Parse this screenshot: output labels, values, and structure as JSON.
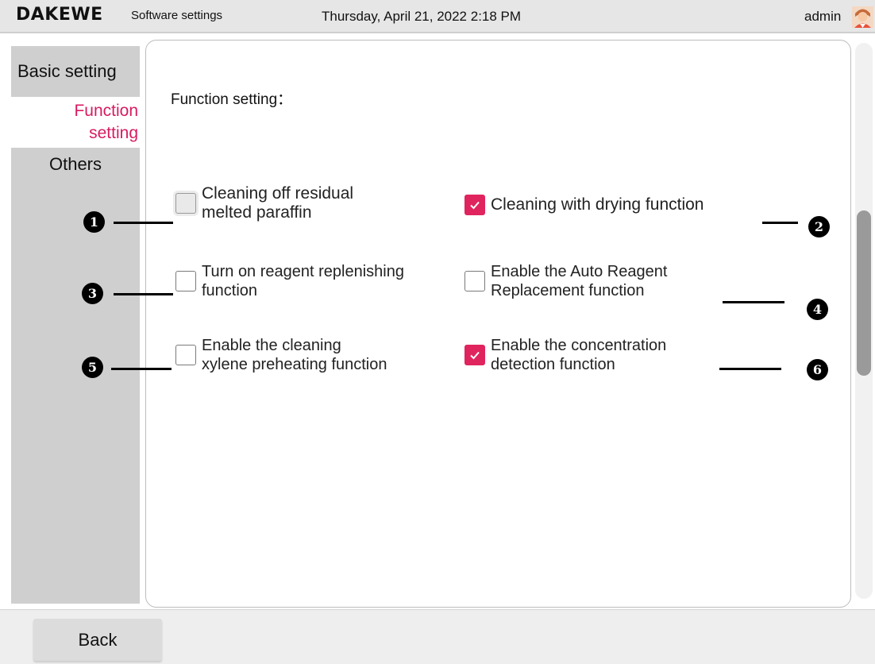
{
  "header": {
    "logo": "DAKEWE",
    "app_title": "Software settings",
    "datetime": "Thursday, April 21, 2022  2:18 PM",
    "user": "admin"
  },
  "sidebar": {
    "items": [
      {
        "label": "Basic setting",
        "selected": false
      },
      {
        "label": "Function setting",
        "line1": "Function",
        "line2": "setting",
        "selected": true
      },
      {
        "label": "Others",
        "selected": false
      }
    ],
    "selected_color": "#d81b60"
  },
  "main": {
    "section_title": "Function setting：",
    "options": [
      {
        "line1": "Cleaning off residual",
        "line2": "melted paraffin",
        "checked": false,
        "marker": "1"
      },
      {
        "line1": "Cleaning with drying function",
        "line2": "",
        "checked": true,
        "marker": "2"
      },
      {
        "line1": "Turn on reagent replenishing",
        "line2": "function",
        "checked": false,
        "marker": "3"
      },
      {
        "line1": "Enable the Auto Reagent",
        "line2": "Replacement function",
        "checked": false,
        "marker": "4"
      },
      {
        "line1": "Enable the cleaning",
        "line2": "xylene preheating function",
        "checked": false,
        "marker": "5"
      },
      {
        "line1": "Enable the concentration",
        "line2": "detection function",
        "checked": true,
        "marker": "6"
      }
    ],
    "accent_color": "#e0245e"
  },
  "footer": {
    "back_label": "Back"
  },
  "icons": {
    "avatar": "user-avatar-icon",
    "check": "check-icon"
  }
}
